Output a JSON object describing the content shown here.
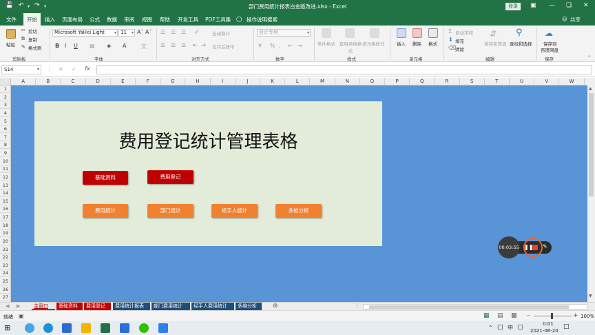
{
  "window": {
    "title": "部门费用统计报表白金版改进.xlsx - Excel",
    "login_label": "登录",
    "share_label": "共享"
  },
  "tabs": [
    "文件",
    "开始",
    "插入",
    "页面布局",
    "公式",
    "数据",
    "审阅",
    "视图",
    "帮助",
    "开发工具",
    "PDF工具集"
  ],
  "active_tab": 1,
  "tell_me": "操作说明搜索",
  "ribbon": {
    "clipboard": {
      "paste": "粘贴",
      "cut": "剪切",
      "copy": "复制",
      "format_painter": "格式刷",
      "group": "剪贴板"
    },
    "font": {
      "name": "Microsoft YaHei Light",
      "size": "11",
      "bold": "B",
      "italic": "I",
      "underline": "U",
      "group": "字体"
    },
    "alignment": {
      "wrap": "自动换行",
      "merge": "合并后居中",
      "group": "对齐方式"
    },
    "number": {
      "format": "会计专用",
      "group": "数字"
    },
    "styles": {
      "conditional": "条件格式",
      "table": "套用表格格式",
      "cell": "单元格样式",
      "group": "样式"
    },
    "cells": {
      "insert": "插入",
      "delete": "删除",
      "format": "格式",
      "group": "单元格"
    },
    "editing": {
      "autosum": "自动求和",
      "fill": "填充",
      "clear": "清除",
      "sort": "排序和筛选",
      "find": "查找和选择",
      "group": "编辑"
    },
    "save": {
      "label1": "保存到",
      "label2": "百度网盘",
      "group": "保存"
    }
  },
  "formula_bar": {
    "name_box": "S14",
    "fx": "fx",
    "formula": ""
  },
  "columns": [
    "A",
    "B",
    "C",
    "D",
    "E",
    "F",
    "G",
    "H",
    "I",
    "J",
    "K",
    "L",
    "M",
    "N",
    "O",
    "P",
    "Q",
    "R",
    "S",
    "T",
    "U",
    "V",
    "W"
  ],
  "rows": [
    "1",
    "2",
    "3",
    "4",
    "5",
    "6",
    "7",
    "8",
    "9",
    "10",
    "11",
    "12",
    "13",
    "14",
    "15",
    "16",
    "17",
    "18",
    "19",
    "20",
    "21",
    "22",
    "23",
    "24",
    "25",
    "26",
    "27"
  ],
  "panel": {
    "title": "费用登记统计管理表格",
    "buttons": [
      {
        "label": "基础资料",
        "style": "red"
      },
      {
        "label": "费用登记",
        "style": "red"
      },
      {
        "label": "费用统计",
        "style": "orange"
      },
      {
        "label": "部门统计",
        "style": "orange"
      },
      {
        "label": "经手人统计",
        "style": "orange"
      },
      {
        "label": "多维分析",
        "style": "orange"
      }
    ]
  },
  "recorder": {
    "time": "00:03:55"
  },
  "sheet_tabs": [
    {
      "label": "主窗口",
      "color": "#e8e8e8",
      "text": "#c00000"
    },
    {
      "label": "基础资料",
      "color": "#c00000",
      "text": "#ffffff"
    },
    {
      "label": "费用登记",
      "color": "#c00000",
      "text": "#ffffff"
    },
    {
      "label": "费用统计报表",
      "color": "#1f4e79",
      "text": "#ffffff"
    },
    {
      "label": "部门费用统计",
      "color": "#1f4e79",
      "text": "#ffffff"
    },
    {
      "label": "经手人费用统计",
      "color": "#1f4e79",
      "text": "#ffffff"
    },
    {
      "label": "多维分析",
      "color": "#1f4e79",
      "text": "#ffffff"
    }
  ],
  "status": {
    "ready": "就绪",
    "zoom": "100%"
  },
  "taskbar": {
    "ime": "中",
    "time": "0:01",
    "date": "2021-06-20"
  },
  "colors": {
    "excel_green": "#217346",
    "sheet_bg": "#5894d6",
    "panel_bg": "#e3ebd9",
    "red_button": "#c00000",
    "orange_button": "#f08131"
  }
}
